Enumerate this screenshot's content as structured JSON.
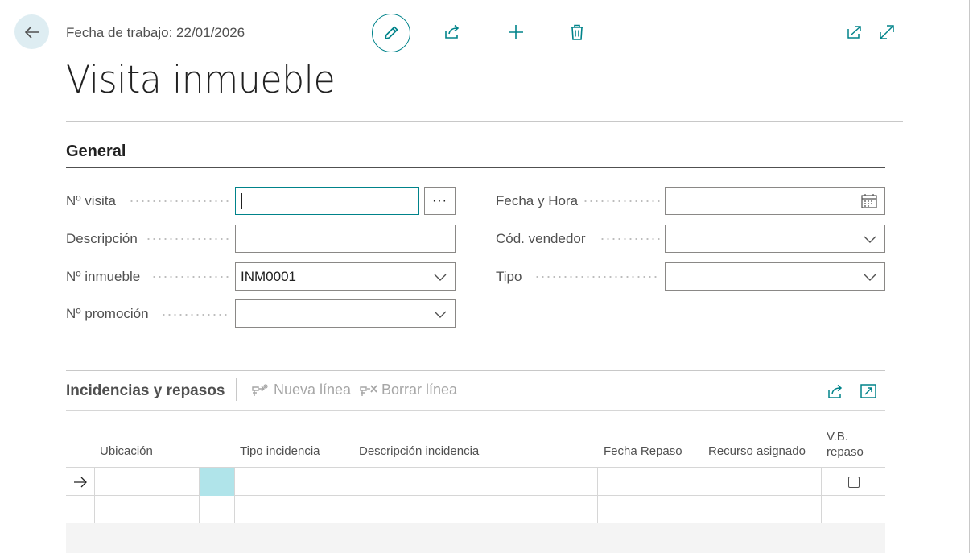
{
  "header": {
    "work_date": "Fecha de trabajo: 22/01/2026",
    "icons": {
      "back": "arrow-left",
      "edit": "pencil",
      "share": "share",
      "new": "plus",
      "delete": "trash",
      "open_new_window": "open-in-new-window",
      "expand": "expand"
    }
  },
  "page": {
    "title": "Visita inmueble"
  },
  "general": {
    "title": "General",
    "fields_left": [
      {
        "label": "Nº visita",
        "value": ""
      },
      {
        "label": "Descripción",
        "value": ""
      },
      {
        "label": "Nº inmueble",
        "value": "INM0001"
      },
      {
        "label": "Nº promoción",
        "value": ""
      }
    ],
    "fields_right": [
      {
        "label": "Fecha y Hora",
        "value": ""
      },
      {
        "label": "Cód. vendedor",
        "value": ""
      },
      {
        "label": "Tipo",
        "value": ""
      }
    ],
    "lookup_label": "···"
  },
  "subpage": {
    "title": "Incidencias y repasos",
    "actions": {
      "new_line": "Nueva línea",
      "delete_line": "Borrar línea"
    },
    "columns": {
      "ubicacion": "Ubicación",
      "tipo_incidencia": "Tipo incidencia",
      "descripcion_incidencia": "Descripción incidencia",
      "fecha_repaso": "Fecha Repaso",
      "recurso_asignado": "Recurso asignado",
      "vb_repaso_line1": "V.B.",
      "vb_repaso_line2": "repaso"
    },
    "rows": [
      {
        "current": true,
        "ubicacion": "",
        "tipo_incidencia": "",
        "descripcion_incidencia": "",
        "fecha_repaso": "",
        "recurso_asignado": "",
        "vb_repaso": false
      },
      {
        "current": false,
        "ubicacion": "",
        "tipo_incidencia": "",
        "descripcion_incidencia": "",
        "fecha_repaso": "",
        "recurso_asignado": "",
        "vb_repaso": null
      }
    ]
  },
  "colors": {
    "accent": "#00838a",
    "selected_cell": "#b0e4ea",
    "back_bg": "#deedf2"
  }
}
